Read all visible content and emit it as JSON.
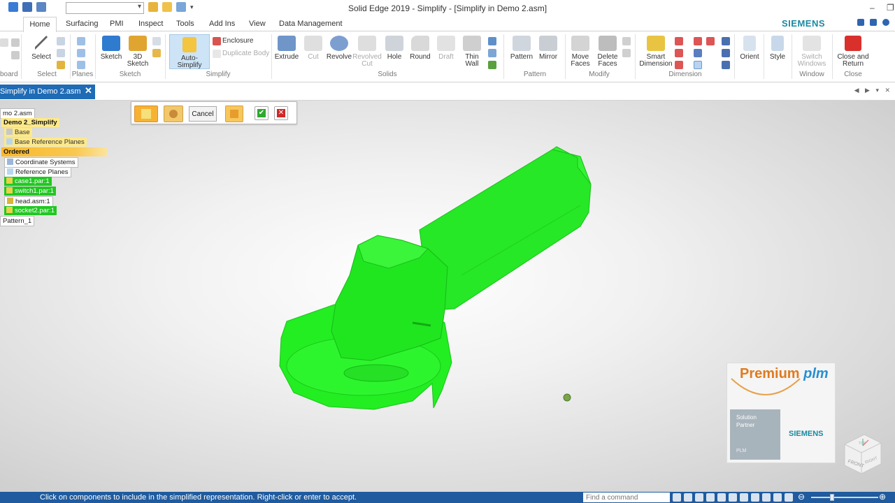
{
  "window": {
    "title": "Solid Edge 2019 - Simplify - [Simplify in Demo 2.asm]",
    "minimize": "–",
    "restore": "❐",
    "close": "✕"
  },
  "tabs": [
    "Home",
    "Surfacing",
    "PMI",
    "Inspect",
    "Tools",
    "Add Ins",
    "View",
    "Data Management"
  ],
  "brand": "SIEMENS",
  "ribbon": {
    "clipboard_group": "board",
    "select": {
      "label": "Select",
      "group": "Select"
    },
    "planes_group": "Planes",
    "sketch": {
      "label": "Sketch",
      "group": "Sketch"
    },
    "sketch3d": {
      "label1": "3D",
      "label2": "Sketch"
    },
    "auto_simplify": {
      "label": "Auto-Simplify"
    },
    "enclosure": "Enclosure",
    "duplicate_body": "Duplicate Body",
    "simplify_group": "Simplify",
    "extrude": "Extrude",
    "cut": "Cut",
    "revolve": "Revolve",
    "revolved_cut": {
      "label1": "Revolved",
      "label2": "Cut"
    },
    "hole": "Hole",
    "round": "Round",
    "draft": "Draft",
    "thin_wall": {
      "label1": "Thin",
      "label2": "Wall"
    },
    "solids_group": "Solids",
    "pattern": "Pattern",
    "mirror": "Mirror",
    "pattern_group": "Pattern",
    "move_faces": {
      "label1": "Move",
      "label2": "Faces"
    },
    "delete_faces": {
      "label1": "Delete",
      "label2": "Faces"
    },
    "modify_group": "Modify",
    "smart_dimension": {
      "label1": "Smart",
      "label2": "Dimension"
    },
    "dimension_group": "Dimension",
    "orient": "Orient",
    "style": "Style",
    "switch_windows": {
      "label1": "Switch",
      "label2": "Windows"
    },
    "window_group": "Window",
    "close_return": {
      "label1": "Close and",
      "label2": "Return"
    },
    "close_group": "Close"
  },
  "document_tab": {
    "label": "Simplify in Demo 2.asm",
    "close": "✕"
  },
  "docbar_nav": "◀ ▶ ▾ ✕",
  "tree": {
    "root": "mo 2.asm",
    "simplify": "Demo 2_Simplify",
    "base": "Base",
    "base_ref_planes": "Base Reference Planes",
    "ordered": "Ordered",
    "coord_systems": "Coordinate Systems",
    "ref_planes": "Reference Planes",
    "case": "case1.par:1",
    "switch": "switch1.par:1",
    "head": "head.asm:1",
    "socket": "socket2.par:1",
    "pattern": "Pattern_1"
  },
  "command_bar": {
    "cancel": "Cancel"
  },
  "logo": {
    "premium": "Premium",
    "plm": "plm",
    "partner_line1": "Solution",
    "partner_line2": "Partner",
    "partner_plm": "PLM",
    "siemens": "SIEMENS"
  },
  "view_cube": {
    "front": "FRONT",
    "right": "RIGHT",
    "top": "TOP"
  },
  "status": {
    "message": "Click on components to include in the simplified representation. Right-click or enter to accept.",
    "find_placeholder": "Find a command"
  },
  "colors": {
    "accent": "#1f6bb5",
    "status_bar": "#1f5b9e",
    "model_green": "#22ee22",
    "brand_teal": "#1a8aa0",
    "selection_green": "#22c722"
  }
}
